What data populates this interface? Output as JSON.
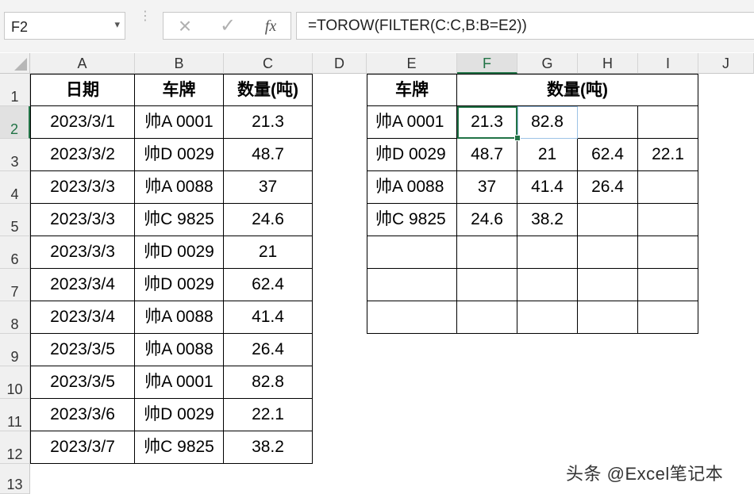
{
  "formula_bar": {
    "name_box": "F2",
    "formula": "=TOROW(FILTER(C:C,B:B=E2))",
    "cancel_icon": "×",
    "enter_icon": "✓",
    "fx_label": "fx"
  },
  "columns": [
    "A",
    "B",
    "C",
    "D",
    "E",
    "F",
    "G",
    "H",
    "I",
    "J"
  ],
  "rows": [
    "1",
    "2",
    "3",
    "4",
    "5",
    "6",
    "7",
    "8",
    "9",
    "10",
    "11",
    "12",
    "13"
  ],
  "active_cell": "F2",
  "source_table": {
    "headers": [
      "日期",
      "车牌",
      "数量(吨)"
    ],
    "rows": [
      [
        "2023/3/1",
        "帅A 0001",
        "21.3"
      ],
      [
        "2023/3/2",
        "帅D 0029",
        "48.7"
      ],
      [
        "2023/3/3",
        "帅A 0088",
        "37"
      ],
      [
        "2023/3/3",
        "帅C 9825",
        "24.6"
      ],
      [
        "2023/3/3",
        "帅D 0029",
        "21"
      ],
      [
        "2023/3/4",
        "帅D 0029",
        "62.4"
      ],
      [
        "2023/3/4",
        "帅A 0088",
        "41.4"
      ],
      [
        "2023/3/5",
        "帅A 0088",
        "26.4"
      ],
      [
        "2023/3/5",
        "帅A 0001",
        "82.8"
      ],
      [
        "2023/3/6",
        "帅D 0029",
        "22.1"
      ],
      [
        "2023/3/7",
        "帅C 9825",
        "38.2"
      ]
    ]
  },
  "result_table": {
    "header_plate": "车牌",
    "header_qty": "数量(吨)",
    "rows": [
      [
        "帅A 0001",
        "21.3",
        "82.8",
        "",
        ""
      ],
      [
        "帅D 0029",
        "48.7",
        "21",
        "62.4",
        "22.1"
      ],
      [
        "帅A 0088",
        "37",
        "41.4",
        "26.4",
        ""
      ],
      [
        "帅C 9825",
        "24.6",
        "38.2",
        "",
        ""
      ],
      [
        "",
        "",
        "",
        "",
        ""
      ],
      [
        "",
        "",
        "",
        "",
        ""
      ],
      [
        "",
        "",
        "",
        "",
        ""
      ]
    ]
  },
  "watermark": "头条 @Excel笔记本"
}
